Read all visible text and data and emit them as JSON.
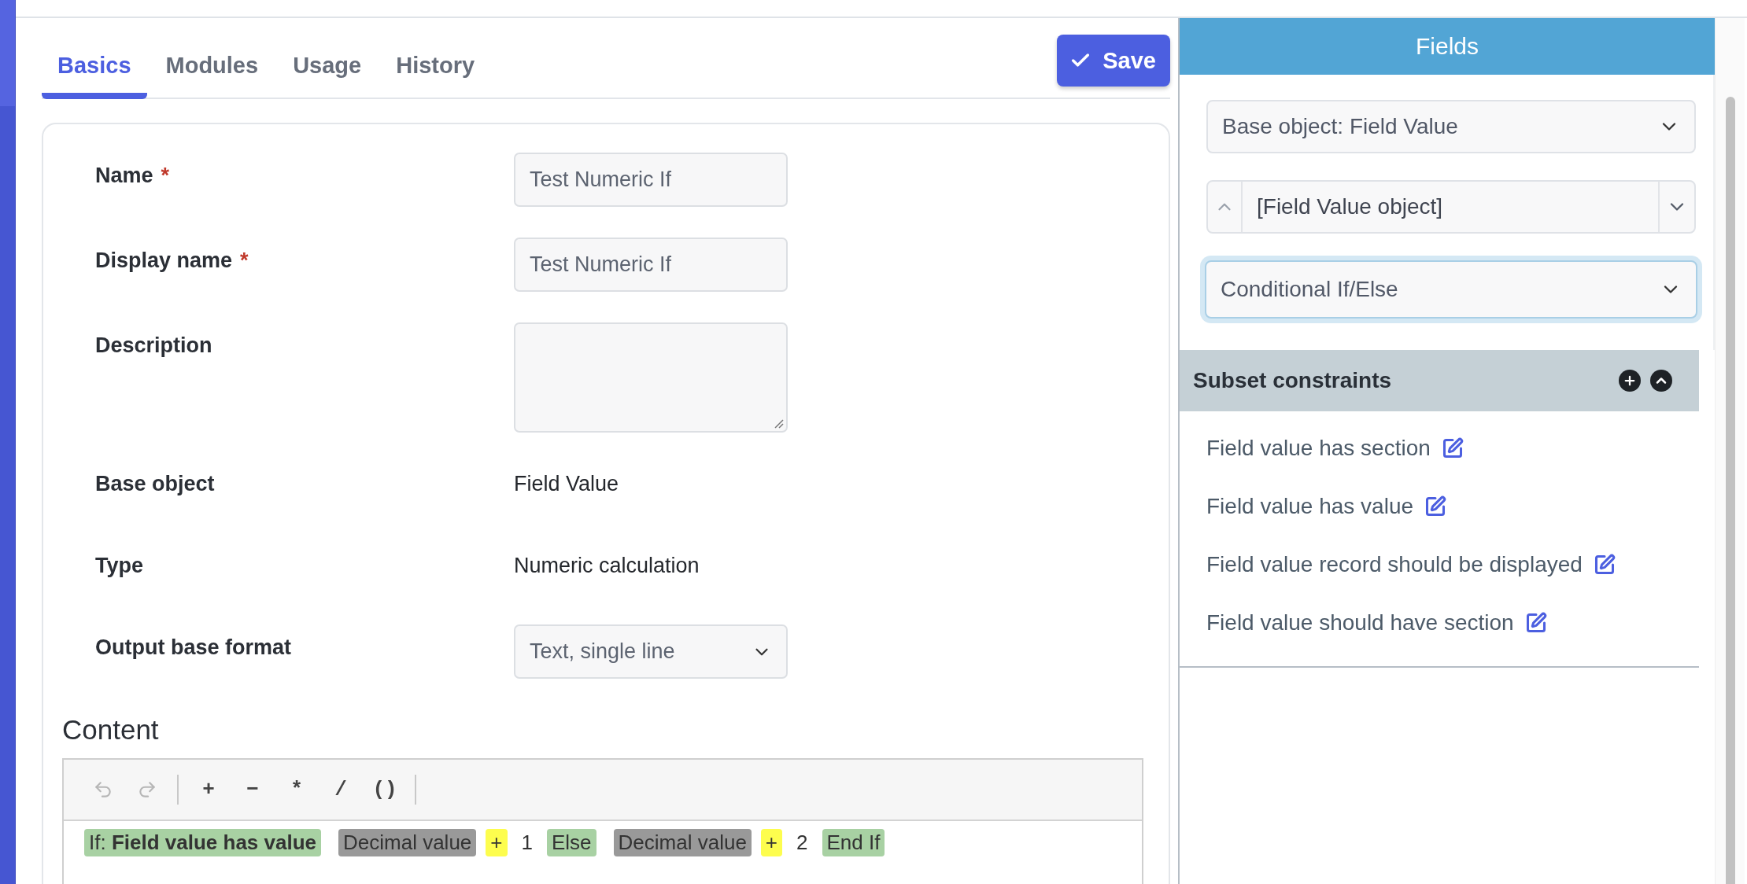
{
  "tabs": [
    {
      "label": "Basics",
      "selected": true
    },
    {
      "label": "Modules",
      "selected": false
    },
    {
      "label": "Usage",
      "selected": false
    },
    {
      "label": "History",
      "selected": false
    }
  ],
  "save_button": {
    "label": "Save"
  },
  "form": {
    "fields": [
      {
        "kind": "input",
        "label": "Name",
        "required_mark": "*",
        "value": "Test Numeric If"
      },
      {
        "kind": "input",
        "label": "Display name",
        "required_mark": "*",
        "value": "Test Numeric If"
      },
      {
        "kind": "textarea",
        "label": "Description"
      },
      {
        "kind": "text",
        "label": "Base object",
        "value": "Field Value"
      },
      {
        "kind": "text",
        "label": "Type",
        "value": "Numeric calculation"
      },
      {
        "kind": "select",
        "label": "Output base format",
        "value": "Text, single line"
      }
    ]
  },
  "content": {
    "heading": "Content",
    "toolbar": {
      "history": [
        {
          "kind": "undo",
          "disabled": true
        },
        {
          "kind": "redo",
          "disabled": true
        }
      ],
      "operators": [
        "+",
        "−",
        "*",
        "/",
        "()"
      ]
    },
    "tokens": [
      {
        "kind": "condition",
        "text": "If: **Field value has value**"
      },
      {
        "kind": "field",
        "text": "Decimal value"
      },
      {
        "kind": "operator",
        "text": "+"
      },
      {
        "kind": "number",
        "text": "1"
      },
      {
        "kind": "keyword",
        "text": "Else"
      },
      {
        "kind": "field",
        "text": "Decimal value"
      },
      {
        "kind": "operator",
        "text": "+"
      },
      {
        "kind": "number",
        "text": "2"
      },
      {
        "kind": "keyword",
        "text": "End If"
      }
    ]
  },
  "fields_panel": {
    "title": "Fields",
    "selects": [
      {
        "kind": "select",
        "value": "Base object: Field Value"
      },
      {
        "kind": "stepper",
        "value": "[Field Value object]"
      },
      {
        "kind": "select",
        "value": "Conditional If/Else",
        "focused": true
      }
    ],
    "subset": {
      "title": "Subset constraints",
      "expanded": true,
      "items": [
        "Field value has section",
        "Field value has value",
        "Field value record should be displayed",
        "Field value should have section"
      ]
    }
  }
}
